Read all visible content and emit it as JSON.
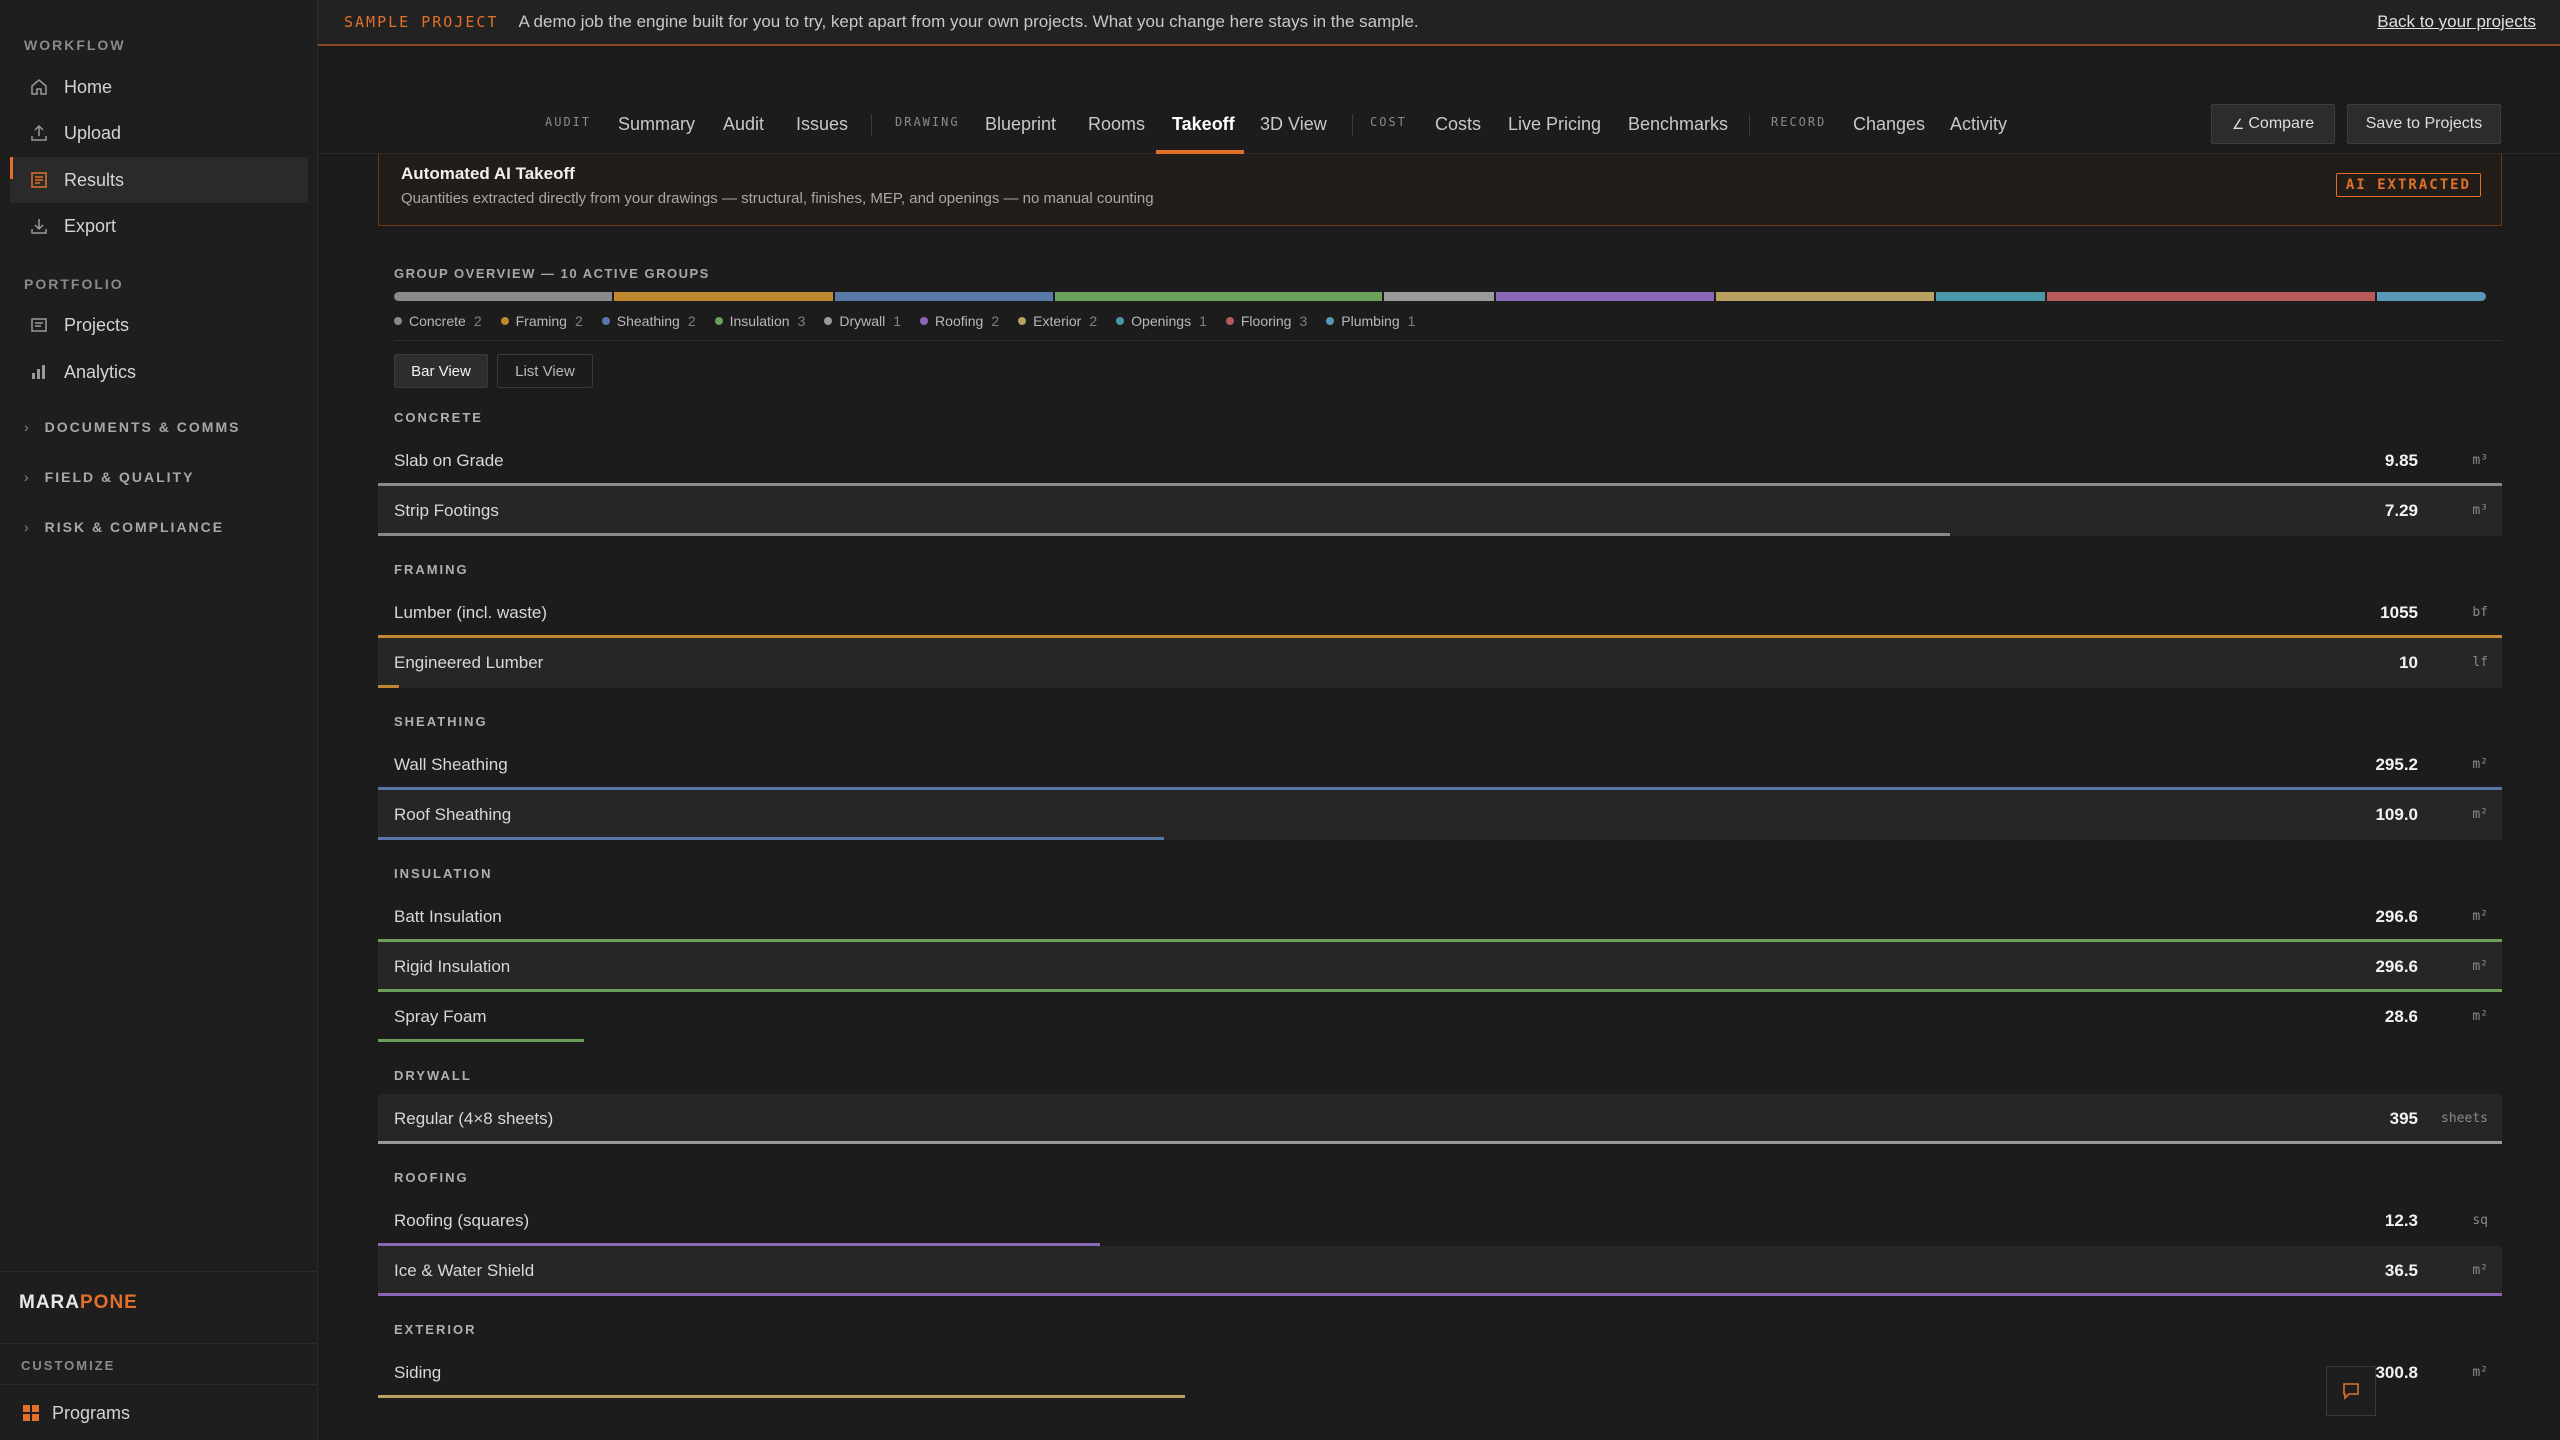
{
  "sidebar": {
    "workflow_label": "WORKFLOW",
    "portfolio_label": "PORTFOLIO",
    "workflow": [
      {
        "label": "Home",
        "icon": "home-icon"
      },
      {
        "label": "Upload",
        "icon": "upload-icon"
      },
      {
        "label": "Results",
        "icon": "results-icon",
        "active": true
      },
      {
        "label": "Export",
        "icon": "export-icon"
      }
    ],
    "portfolio": [
      {
        "label": "Projects",
        "icon": "projects-icon"
      },
      {
        "label": "Analytics",
        "icon": "analytics-icon"
      }
    ],
    "collapsibles": [
      "DOCUMENTS & COMMS",
      "FIELD & QUALITY",
      "RISK & COMPLIANCE"
    ],
    "logo_a": "MARA",
    "logo_b": "PONE",
    "customize_label": "CUSTOMIZE",
    "programs_label": "Programs"
  },
  "banner": {
    "tag": "SAMPLE PROJECT",
    "message": "A demo job the engine built for you to try, kept apart from your own projects. What you change here stays in the sample.",
    "back_link": "Back to your projects"
  },
  "topnav": {
    "audit_label": "AUDIT",
    "drawing_label": "DRAWING",
    "cost_label": "COST",
    "record_label": "RECORD",
    "summary": "Summary",
    "audit": "Audit",
    "issues": "Issues",
    "blueprint": "Blueprint",
    "rooms": "Rooms",
    "takeoff": "Takeoff",
    "view3d": "3D View",
    "costs": "Costs",
    "live_pricing": "Live Pricing",
    "benchmarks": "Benchmarks",
    "changes": "Changes",
    "activity": "Activity",
    "compare": "Compare",
    "save": "Save to Projects"
  },
  "info": {
    "title": "Automated AI Takeoff",
    "subtitle": "Quantities extracted directly from your drawings — structural, finishes, MEP, and openings — no manual counting",
    "badge": "AI EXTRACTED"
  },
  "overview": {
    "label": "GROUP OVERVIEW — 10 ACTIVE GROUPS",
    "groups": [
      {
        "name": "Concrete",
        "count": "2",
        "color": "#8a8a8a"
      },
      {
        "name": "Framing",
        "count": "2",
        "color": "#c0882e"
      },
      {
        "name": "Sheathing",
        "count": "2",
        "color": "#5878a8"
      },
      {
        "name": "Insulation",
        "count": "3",
        "color": "#6aa05a"
      },
      {
        "name": "Drywall",
        "count": "1",
        "color": "#9a9a9a"
      },
      {
        "name": "Roofing",
        "count": "2",
        "color": "#8a68b8"
      },
      {
        "name": "Exterior",
        "count": "2",
        "color": "#b8a060"
      },
      {
        "name": "Openings",
        "count": "1",
        "color": "#4a98a8"
      },
      {
        "name": "Flooring",
        "count": "3",
        "color": "#b85a5a"
      },
      {
        "name": "Plumbing",
        "count": "1",
        "color": "#5a98b8"
      }
    ]
  },
  "view_toggle": {
    "bar": "Bar View",
    "list": "List View"
  },
  "takeoff": [
    {
      "group": "CONCRETE",
      "color": "#8a8a8a",
      "items": [
        {
          "name": "Slab on Grade",
          "value": "9.85",
          "unit": "m³",
          "fill": 1.0
        },
        {
          "name": "Strip Footings",
          "value": "7.29",
          "unit": "m³",
          "fill": 0.74
        }
      ]
    },
    {
      "group": "FRAMING",
      "color": "#c0882e",
      "items": [
        {
          "name": "Lumber (incl. waste)",
          "value": "1055",
          "unit": "bf",
          "fill": 1.0
        },
        {
          "name": "Engineered Lumber",
          "value": "10",
          "unit": "lf",
          "fill": 0.01
        }
      ]
    },
    {
      "group": "SHEATHING",
      "color": "#5878a8",
      "items": [
        {
          "name": "Wall Sheathing",
          "value": "295.2",
          "unit": "m²",
          "fill": 1.0
        },
        {
          "name": "Roof Sheathing",
          "value": "109.0",
          "unit": "m²",
          "fill": 0.37
        }
      ]
    },
    {
      "group": "INSULATION",
      "color": "#6aa05a",
      "items": [
        {
          "name": "Batt Insulation",
          "value": "296.6",
          "unit": "m²",
          "fill": 1.0
        },
        {
          "name": "Rigid Insulation",
          "value": "296.6",
          "unit": "m²",
          "fill": 1.0
        },
        {
          "name": "Spray Foam",
          "value": "28.6",
          "unit": "m²",
          "fill": 0.097
        }
      ]
    },
    {
      "group": "DRYWALL",
      "color": "#9a9a9a",
      "items": [
        {
          "name": "Regular (4×8 sheets)",
          "value": "395",
          "unit": "sheets",
          "fill": 1.0
        }
      ]
    },
    {
      "group": "ROOFING",
      "color": "#8a68b8",
      "items": [
        {
          "name": "Roofing (squares)",
          "value": "12.3",
          "unit": "sq",
          "fill": 0.34
        },
        {
          "name": "Ice & Water Shield",
          "value": "36.5",
          "unit": "m²",
          "fill": 1.0
        }
      ]
    },
    {
      "group": "EXTERIOR",
      "color": "#b8a060",
      "items": [
        {
          "name": "Siding",
          "value": "300.8",
          "unit": "m²",
          "fill": 0.38
        }
      ]
    }
  ]
}
